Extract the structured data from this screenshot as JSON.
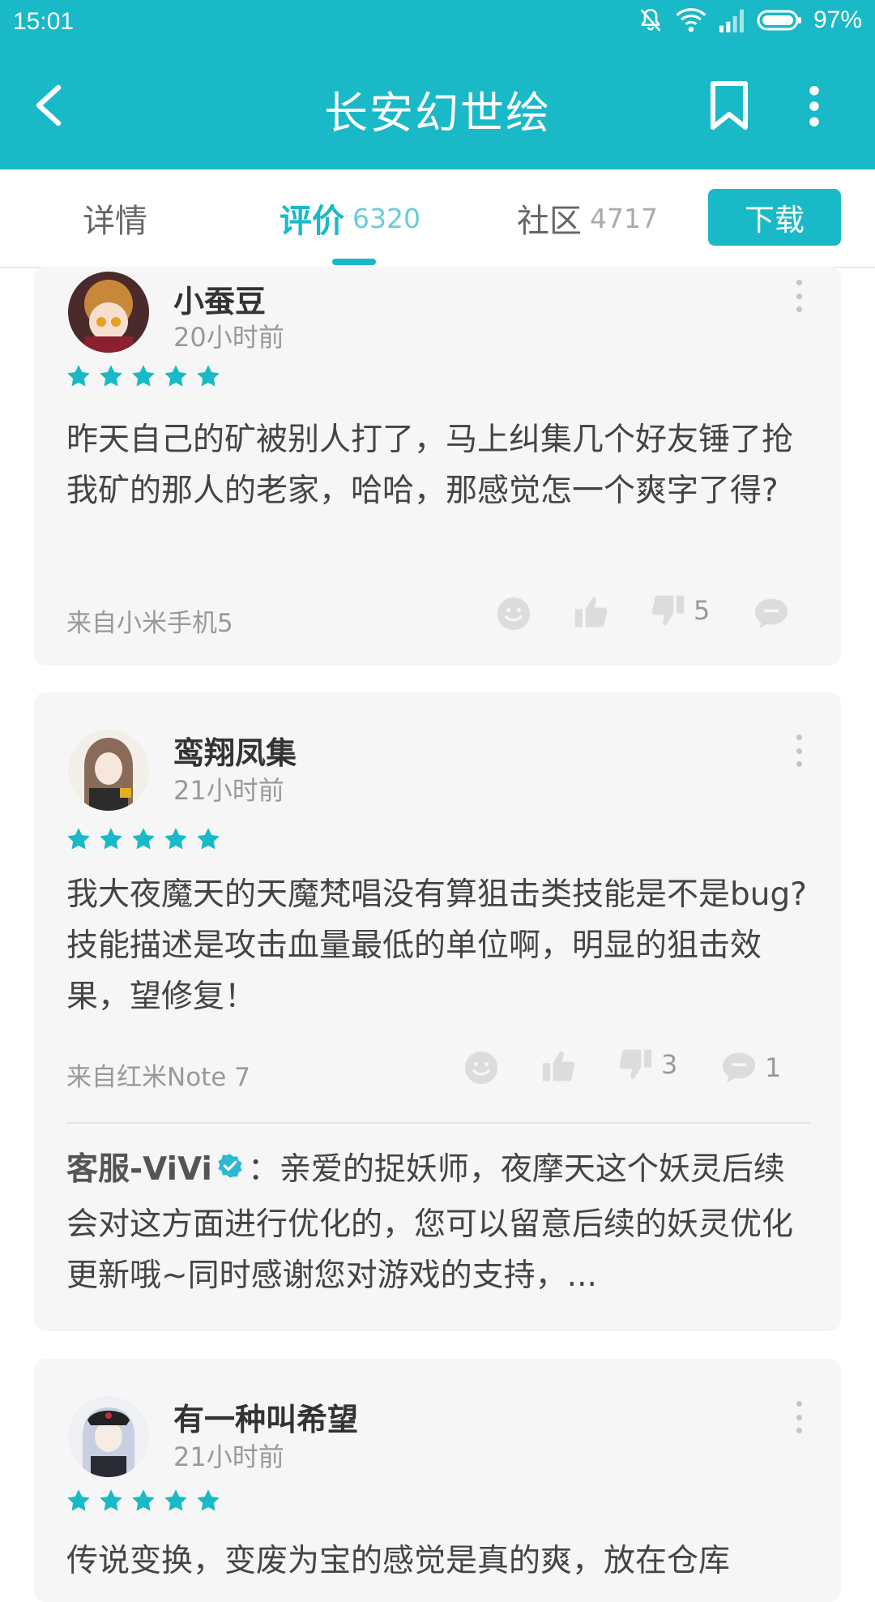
{
  "status": {
    "time": "15:01",
    "battery": "97%"
  },
  "app": {
    "title": "长安幻世绘"
  },
  "tabs": [
    {
      "label": "详情",
      "count": ""
    },
    {
      "label": "评价",
      "count": "6320"
    },
    {
      "label": "社区",
      "count": "4717"
    }
  ],
  "download_label": "下载",
  "reviews": [
    {
      "name": "小蚕豆",
      "time": "20小时前",
      "rating": 5,
      "text": "昨天自己的矿被别人打了，马上纠集几个好友锤了抢我矿的那人的老家，哈哈，那感觉怎一个爽字了得?",
      "device": "来自小米手机5",
      "dislikes": "5",
      "comments": ""
    },
    {
      "name": "鸾翔凤集",
      "time": "21小时前",
      "rating": 5,
      "text": "我大夜魔天的天魔梵唱没有算狙击类技能是不是bug? 技能描述是攻击血量最低的单位啊，明显的狙击效果，望修复！",
      "device": "来自红米Note 7",
      "dislikes": "3",
      "comments": "1",
      "reply_author": "客服-ViVi",
      "reply_text": "：亲爱的捉妖师，夜摩天这个妖灵后续会对这方面进行优化的，您可以留意后续的妖灵优化更新哦~同时感谢您对游戏的支持，..."
    },
    {
      "name": "有一种叫希望",
      "time": "21小时前",
      "rating": 5,
      "text": "传说变换，变废为宝的感觉是真的爽，放在仓库"
    }
  ],
  "colors": {
    "accent": "#19b9c7",
    "star": "#19b9c7",
    "card_bg": "#f6f6f6"
  }
}
